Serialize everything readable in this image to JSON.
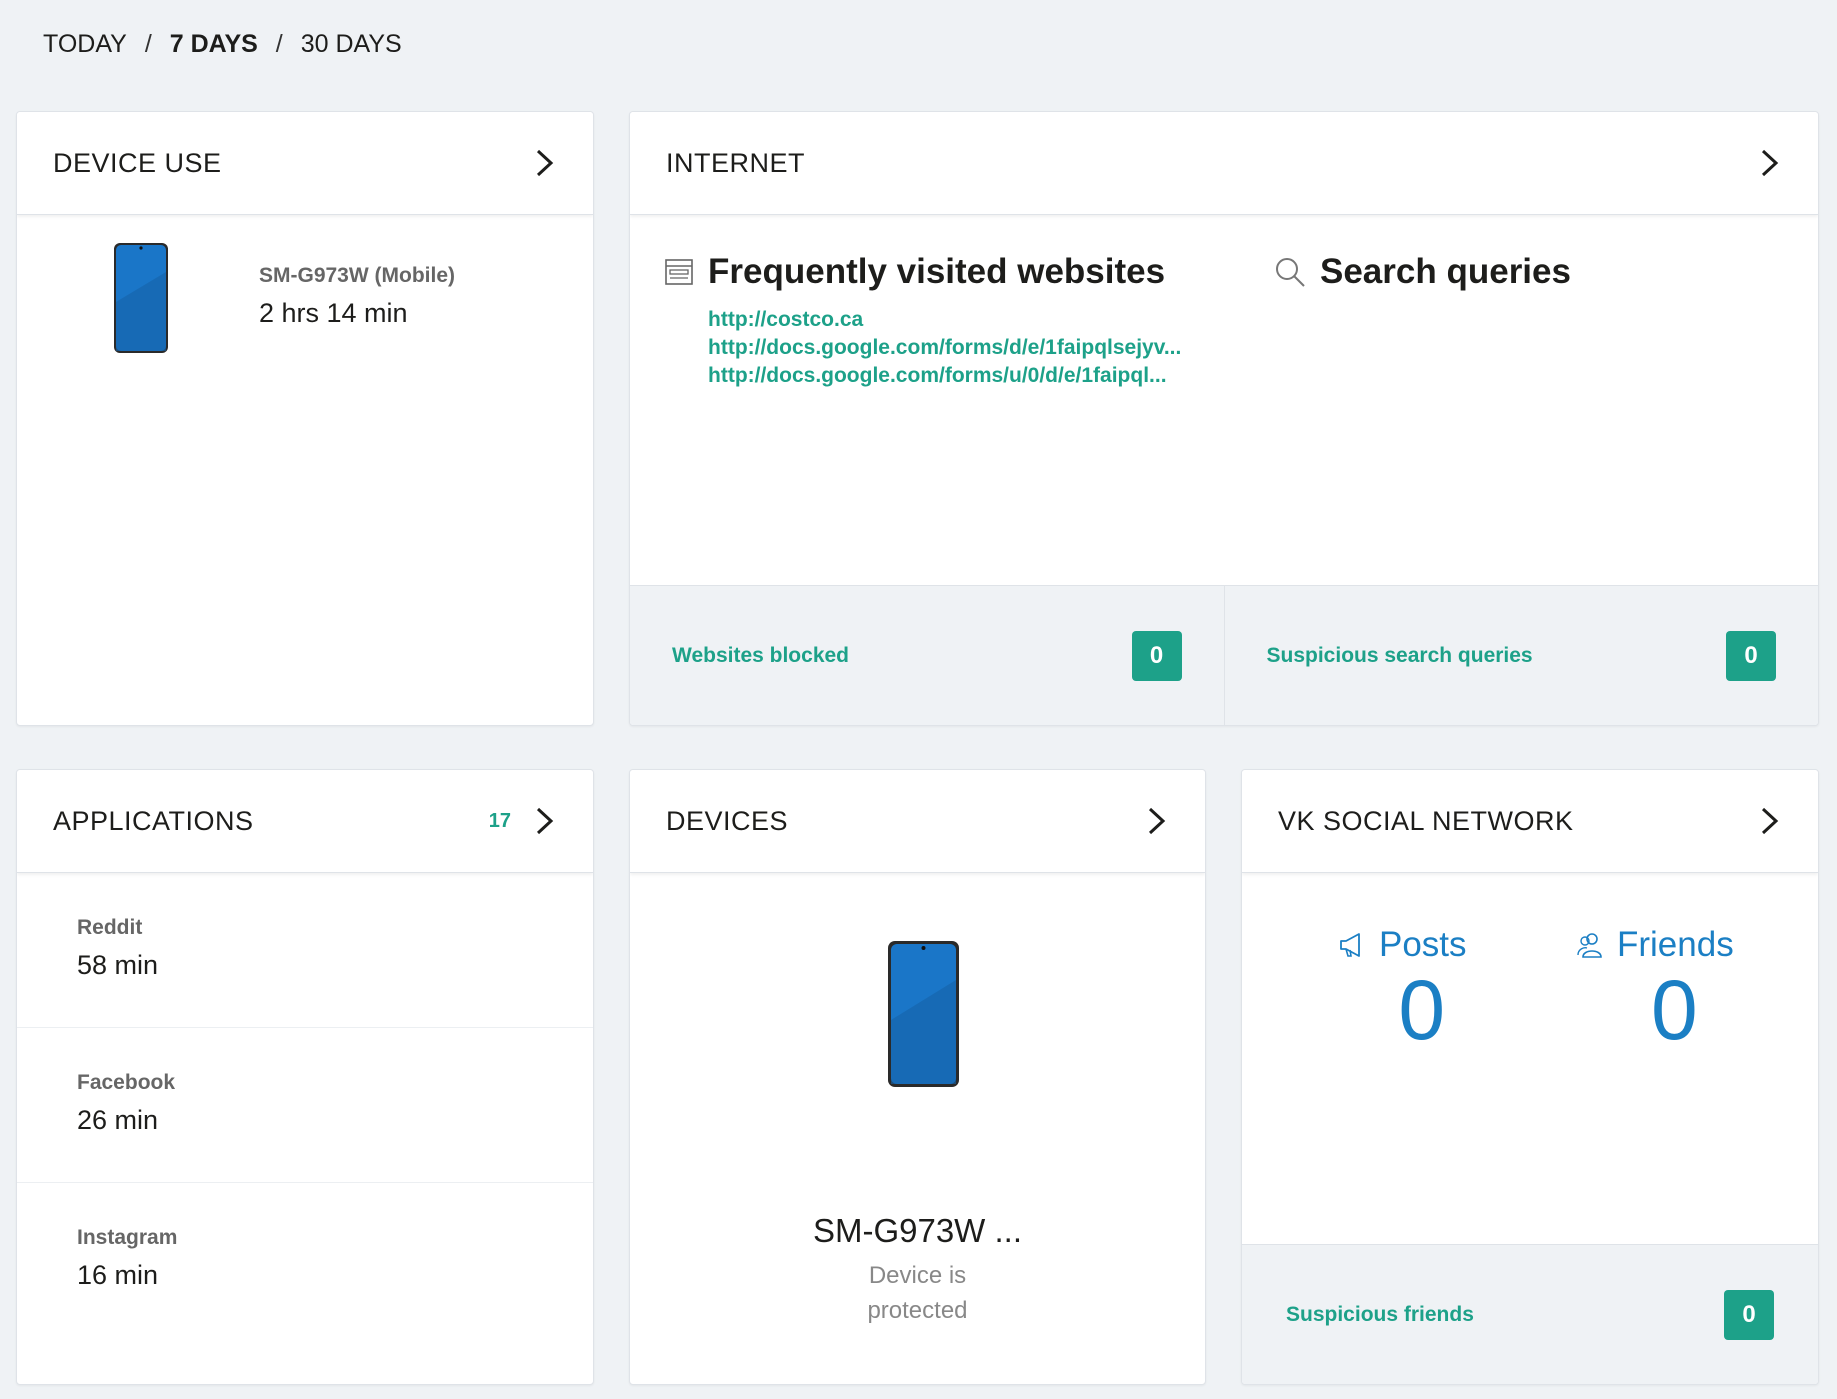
{
  "period_nav": {
    "today": "TODAY",
    "seven_days": "7 DAYS",
    "thirty_days": "30 DAYS",
    "separator": "/"
  },
  "device_use": {
    "title": "DEVICE USE",
    "device_name": "SM-G973W (Mobile)",
    "time": "2 hrs 14 min"
  },
  "internet": {
    "title": "INTERNET",
    "frequent_title": "Frequently visited websites",
    "links": [
      "http://costco.ca",
      "http://docs.google.com/forms/d/e/1faipqlsejyv...",
      "http://docs.google.com/forms/u/0/d/e/1faipql..."
    ],
    "search_title": "Search queries",
    "websites_blocked_label": "Websites blocked",
    "websites_blocked_count": "0",
    "suspicious_queries_label": "Suspicious search queries",
    "suspicious_queries_count": "0"
  },
  "applications": {
    "title": "APPLICATIONS",
    "count": "17",
    "items": [
      {
        "name": "Reddit",
        "time": "58 min"
      },
      {
        "name": "Facebook",
        "time": "26 min"
      },
      {
        "name": "Instagram",
        "time": "16 min"
      }
    ]
  },
  "devices": {
    "title": "DEVICES",
    "device_name": "SM-G973W ...",
    "status": "Device is protected"
  },
  "vk": {
    "title": "VK SOCIAL NETWORK",
    "posts_label": "Posts",
    "posts_value": "0",
    "friends_label": "Friends",
    "friends_value": "0",
    "suspicious_friends_label": "Suspicious friends",
    "suspicious_friends_count": "0"
  },
  "colors": {
    "accent_green": "#1da189",
    "accent_blue": "#1b7fc4",
    "background": "#eff2f5"
  },
  "icons": [
    "chevron-right-icon",
    "browser-window-icon",
    "search-icon",
    "megaphone-icon",
    "friends-icon",
    "phone-image"
  ]
}
